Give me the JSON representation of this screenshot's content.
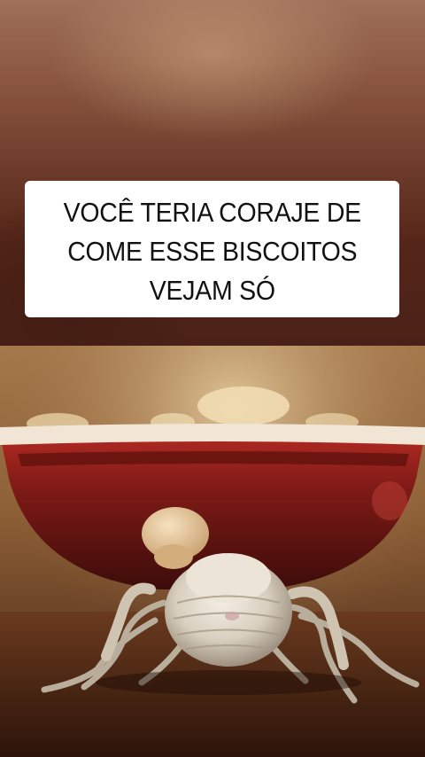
{
  "caption": {
    "text": "VOCÊ TERIA CORAJE DE\nCOME ESSE BISCOITOS\nVEJAM SÓ"
  },
  "colors": {
    "caption_bg": "#ffffff",
    "caption_text": "#111111",
    "bowl_red": "#8a1c1c",
    "insect": "#d8d2c4"
  },
  "scene": {
    "subject": "insect-crawling-near-bowl"
  }
}
